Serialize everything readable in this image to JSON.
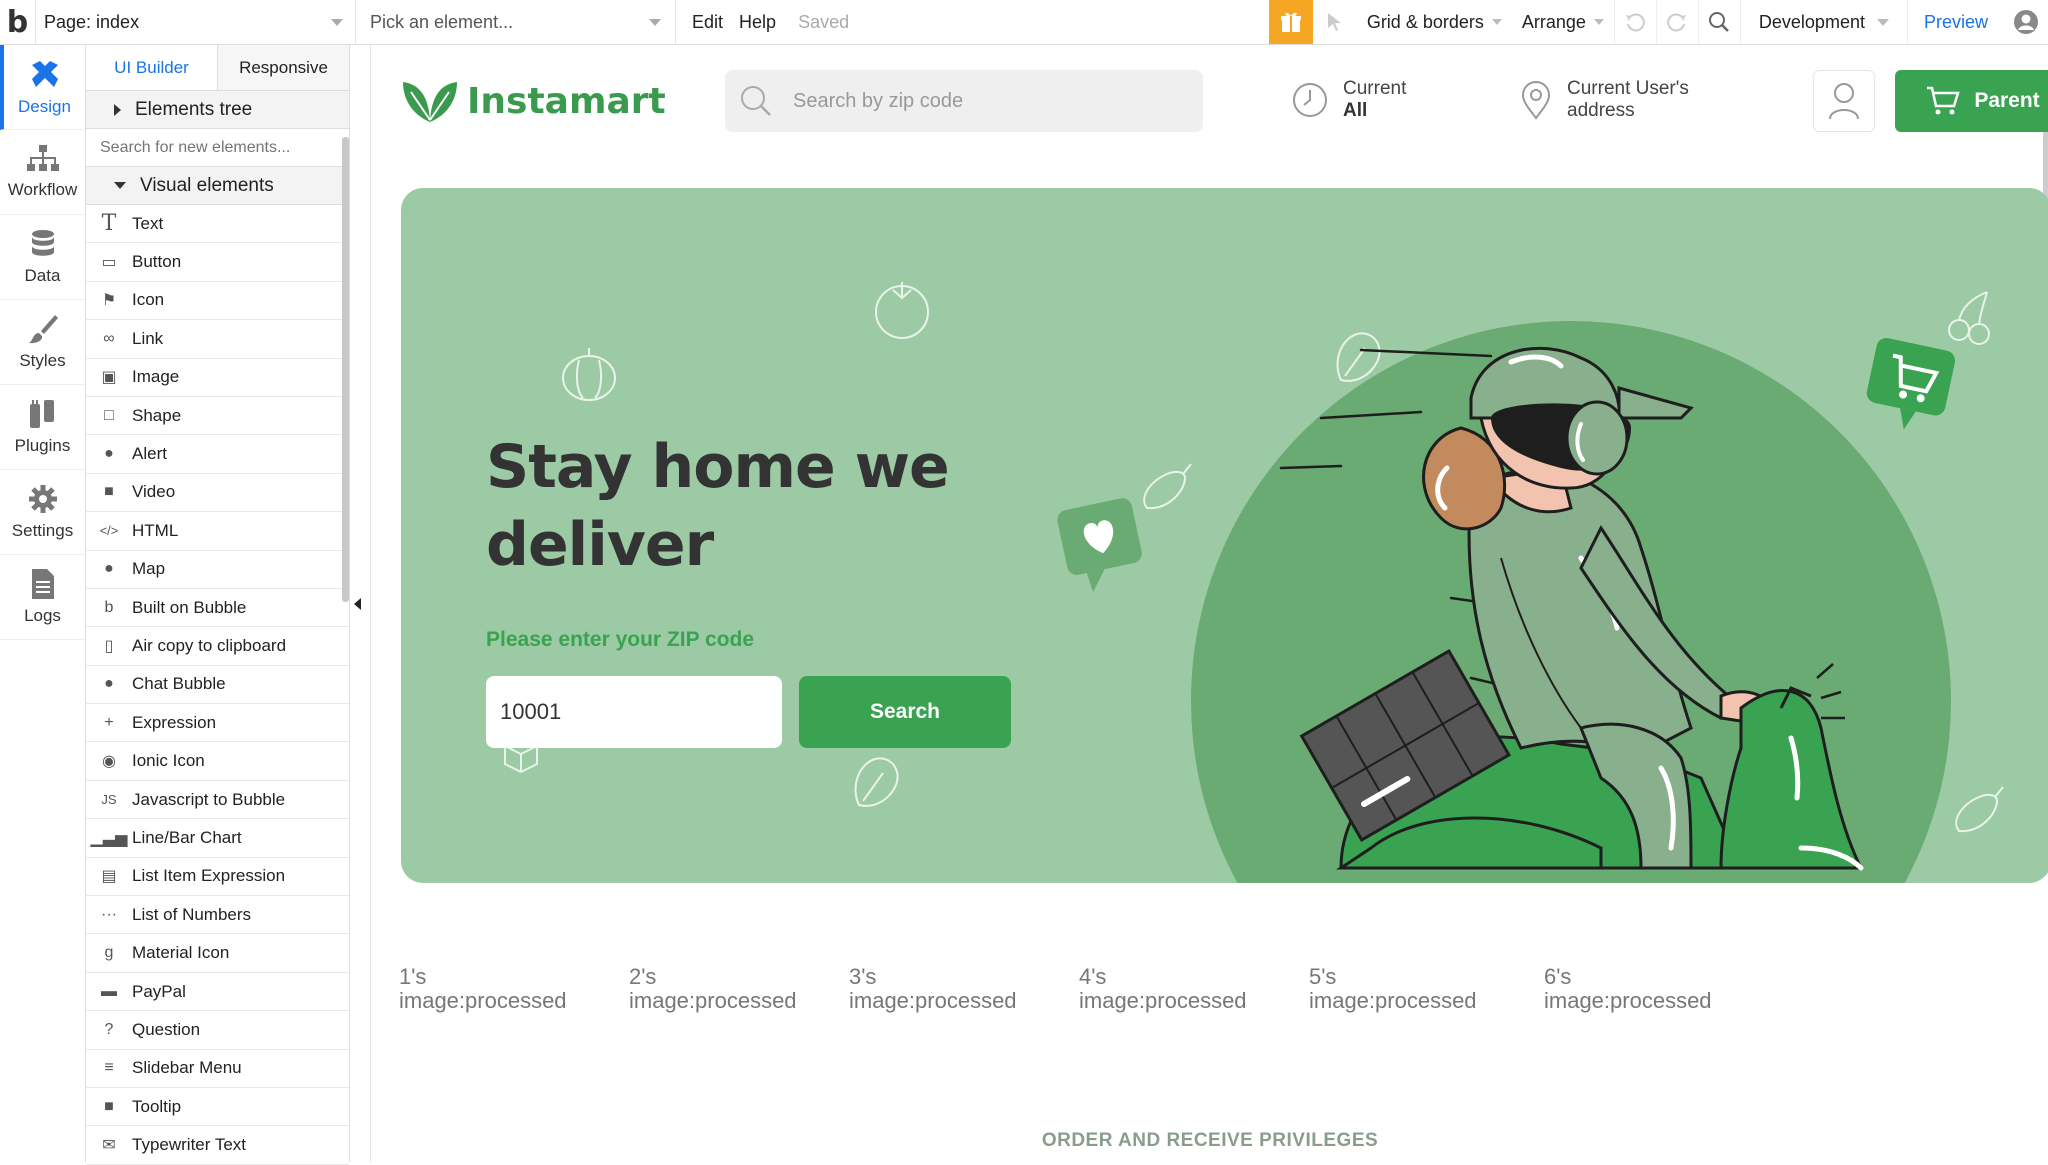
{
  "topbar": {
    "page_label": "Page: index",
    "pick_element": "Pick an element...",
    "menu_edit": "Edit",
    "menu_help": "Help",
    "saved_status": "Saved",
    "grid_borders": "Grid & borders",
    "arrange": "Arrange",
    "environment": "Development",
    "preview": "Preview"
  },
  "rail": [
    {
      "label": "Design",
      "icon": "design-icon",
      "active": true
    },
    {
      "label": "Workflow",
      "icon": "workflow-icon"
    },
    {
      "label": "Data",
      "icon": "database-icon"
    },
    {
      "label": "Styles",
      "icon": "brush-icon"
    },
    {
      "label": "Plugins",
      "icon": "plug-icon"
    },
    {
      "label": "Settings",
      "icon": "gear-icon"
    },
    {
      "label": "Logs",
      "icon": "document-icon"
    }
  ],
  "panel": {
    "tab_builder": "UI Builder",
    "tab_responsive": "Responsive",
    "elements_tree": "Elements tree",
    "search_placeholder": "Search for new elements...",
    "visual_elements": "Visual elements",
    "items": [
      {
        "label": "Text",
        "icon": "text-icon"
      },
      {
        "label": "Button",
        "icon": "button-icon"
      },
      {
        "label": "Icon",
        "icon": "flag-icon"
      },
      {
        "label": "Link",
        "icon": "link-icon"
      },
      {
        "label": "Image",
        "icon": "image-icon"
      },
      {
        "label": "Shape",
        "icon": "square-icon"
      },
      {
        "label": "Alert",
        "icon": "bell-icon"
      },
      {
        "label": "Video",
        "icon": "video-icon"
      },
      {
        "label": "HTML",
        "icon": "code-icon"
      },
      {
        "label": "Map",
        "icon": "map-pin-icon"
      },
      {
        "label": "Built on Bubble",
        "icon": "bubble-logo-icon"
      },
      {
        "label": "Air copy to clipboard",
        "icon": "clipboard-icon"
      },
      {
        "label": "Chat Bubble",
        "icon": "chat-icon"
      },
      {
        "label": "Expression",
        "icon": "plus-icon"
      },
      {
        "label": "Ionic Icon",
        "icon": "ionic-icon"
      },
      {
        "label": "Javascript to Bubble",
        "icon": "js-icon"
      },
      {
        "label": "Line/Bar Chart",
        "icon": "chart-icon"
      },
      {
        "label": "List Item Expression",
        "icon": "list-doc-icon"
      },
      {
        "label": "List of Numbers",
        "icon": "dots-icon"
      },
      {
        "label": "Material Icon",
        "icon": "material-icon"
      },
      {
        "label": "PayPal",
        "icon": "card-icon"
      },
      {
        "label": "Question",
        "icon": "question-icon"
      },
      {
        "label": "Slidebar Menu",
        "icon": "menu-icon"
      },
      {
        "label": "Tooltip",
        "icon": "tooltip-icon"
      },
      {
        "label": "Typewriter Text",
        "icon": "mail-icon"
      }
    ]
  },
  "site": {
    "brand": "Instamart",
    "search_placeholder": "Search by zip code",
    "current_label": "Current",
    "current_value": "All",
    "address_line1": "Current User's",
    "address_line2": "address",
    "cart_label": "Parent",
    "hero_title": "Stay home we deliver",
    "hero_subtitle": "Please enter your ZIP code",
    "zip_value": "10001",
    "search_button": "Search",
    "categories": [
      {
        "l1": "1's",
        "l2": "image:processed with Imgix"
      },
      {
        "l1": "2's",
        "l2": "image:processed with Imgix"
      },
      {
        "l1": "3's",
        "l2": "image:processed with Imgix"
      },
      {
        "l1": "4's",
        "l2": "image:processed with Imgix"
      },
      {
        "l1": "5's",
        "l2": "image:processed with Imgix"
      },
      {
        "l1": "6's",
        "l2": "image:processed with Imgix"
      }
    ],
    "privileges": "ORDER AND RECEIVE PRIVILEGES"
  },
  "colors": {
    "accent_blue": "#1a73e8",
    "brand_green": "#3aa352",
    "hero_bg": "#9ccaa4",
    "hero_circle": "#6aaa73",
    "gift_orange": "#f5a623"
  }
}
